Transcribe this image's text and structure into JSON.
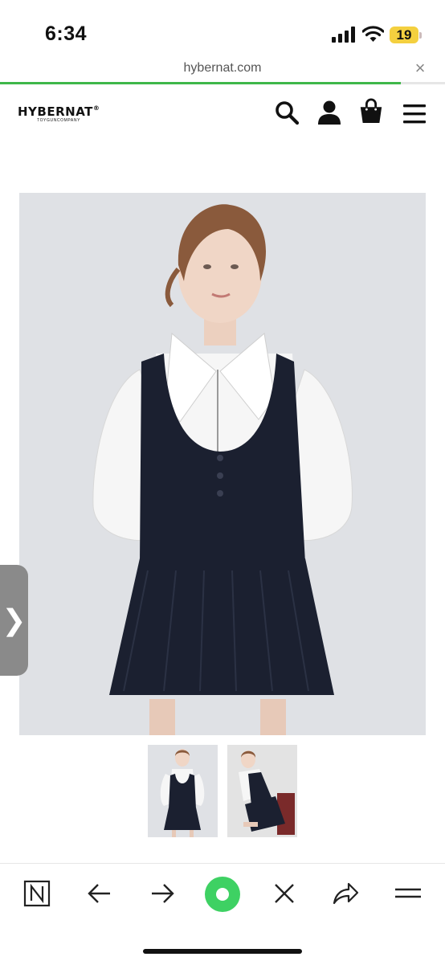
{
  "status_bar": {
    "time": "6:34",
    "battery": "19"
  },
  "browser": {
    "url": "hybernat.com",
    "close_glyph": "×",
    "load_progress": 0.9
  },
  "site": {
    "logo": "HYBERNAT",
    "logo_mark": "®",
    "logo_sub": "TOYGUNCOMPANY"
  },
  "header_icons": [
    "search-icon",
    "user-icon",
    "shopping-bag-icon",
    "menu-icon"
  ],
  "side_tab": {
    "glyph": "❯"
  },
  "thumbnails": 2,
  "toolbar_icons": [
    "naver-n-icon",
    "back-arrow-icon",
    "forward-arrow-icon",
    "green-dot-icon",
    "close-icon",
    "share-icon",
    "menu-icon"
  ],
  "colors": {
    "accent": "#3fb74a",
    "battery": "#f4d03f",
    "dress": "#1b2030",
    "shirt": "#f6f6f6"
  }
}
